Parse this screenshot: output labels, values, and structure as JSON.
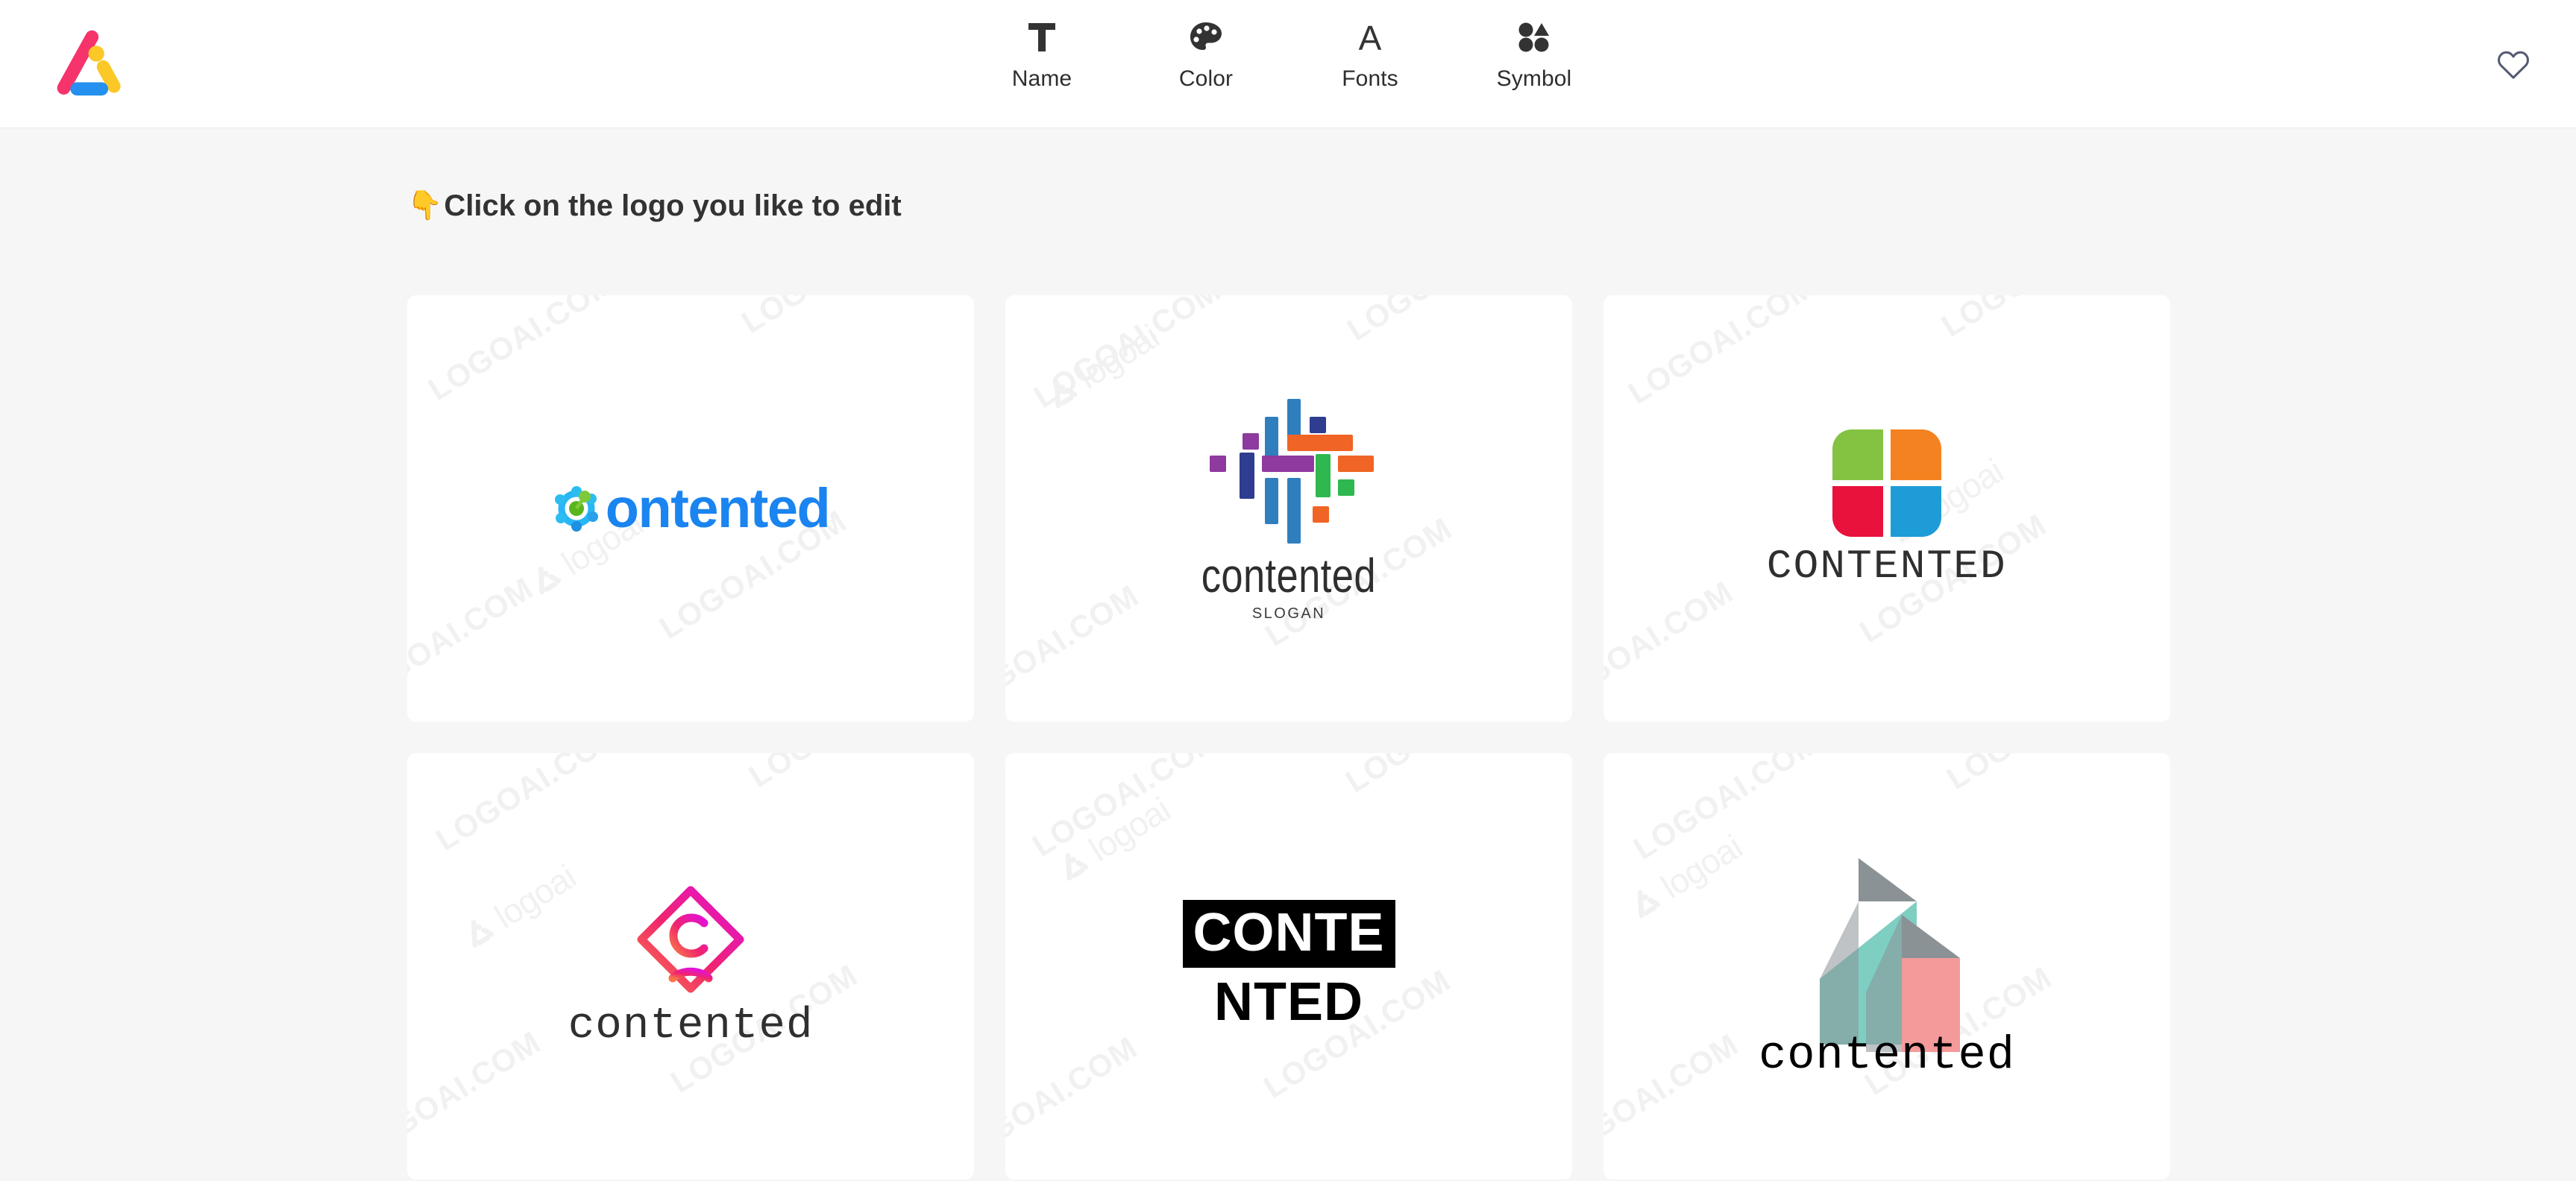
{
  "header": {
    "brand_name": "logoai",
    "brand_icon": "logoai-triangle-mark",
    "nav": [
      {
        "label": "Name",
        "icon": "text-t-icon"
      },
      {
        "label": "Color",
        "icon": "palette-icon"
      },
      {
        "label": "Fonts",
        "icon": "font-a-icon"
      },
      {
        "label": "Symbol",
        "icon": "shapes-icon"
      }
    ],
    "favorite_icon": "heart-outline-icon"
  },
  "main": {
    "headline_emoji": "👇",
    "headline": "Click on the logo you like to edit",
    "watermark_text": "LOGOAI.COM",
    "watermark_name": "logoai"
  },
  "logos": [
    {
      "id": "logo-1",
      "brand_text": "ontented",
      "full_name": "contented",
      "style": "molecule-icon blue wordmark",
      "colors": {
        "text": "#1a84f0",
        "icon_primary": "#29b6f6",
        "icon_accent": "#58c322"
      }
    },
    {
      "id": "logo-2",
      "brand_text": "contented",
      "slogan": "SLOGAN",
      "style": "woven color bars",
      "colors": {
        "blue": "#2f7fbf",
        "navy": "#2e3d8f",
        "purple": "#8e3a9e",
        "orange": "#f06425",
        "green": "#2eb84f",
        "text": "#2e2e2e"
      }
    },
    {
      "id": "logo-3",
      "brand_text": "CONTENTED",
      "style": "four quadrant petals",
      "colors": {
        "green": "#84c342",
        "orange": "#f58220",
        "red": "#e8123c",
        "blue": "#1e9cd7",
        "text": "#2f2f2f"
      }
    },
    {
      "id": "logo-4",
      "brand_text": "contented",
      "style": "gradient diamond monogram",
      "colors": {
        "gradient_start": "#f8764a",
        "gradient_mid": "#f0246e",
        "gradient_end": "#e211d8",
        "text": "#2f2f2f"
      }
    },
    {
      "id": "logo-5",
      "brand_text_line1": "CONTE",
      "brand_text_line2": "NTED",
      "style": "black block reversed type",
      "colors": {
        "box": "#000000",
        "reverse_text": "#ffffff",
        "text": "#000000"
      }
    },
    {
      "id": "logo-6",
      "brand_text": "contented",
      "style": "overlapping arrow triangles",
      "colors": {
        "gray": "#8a9296",
        "teal": "#7fcec2",
        "salmon": "#f49a9a",
        "text": "#000000"
      }
    }
  ],
  "theme": {
    "page_bg": "#f6f6f6",
    "header_bg": "#ffffff",
    "card_bg": "#ffffff",
    "text_dark": "#333333",
    "watermark": "#f1f1f1"
  }
}
